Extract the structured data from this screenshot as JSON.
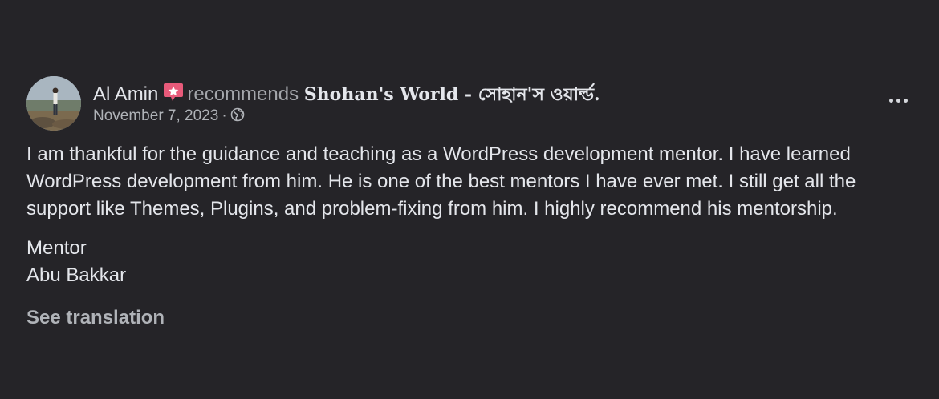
{
  "post": {
    "author": "Al Amin",
    "author_badge_icon": "star-badge-icon",
    "verb": "recommends",
    "page_name": "Shohan's World - সোহান'স ওয়ার্ল্ড.",
    "date": "November 7, 2023",
    "separator": "·",
    "privacy_icon": "globe-icon",
    "more_icon": "more-options-icon",
    "text": "I am thankful for the guidance and teaching as a WordPress development mentor. I have learned WordPress development from him. He is one of the best mentors I have ever met. I still get all the support like Themes, Plugins, and problem-fixing from him. I highly recommend his mentorship.",
    "signature_title": "Mentor",
    "signature_name": "Abu Bakkar",
    "see_translation": "See translation"
  },
  "colors": {
    "background": "#252428",
    "primary_text": "#e4e6eb",
    "secondary_text": "#b0b3b8",
    "badge": "#e85a7a"
  }
}
